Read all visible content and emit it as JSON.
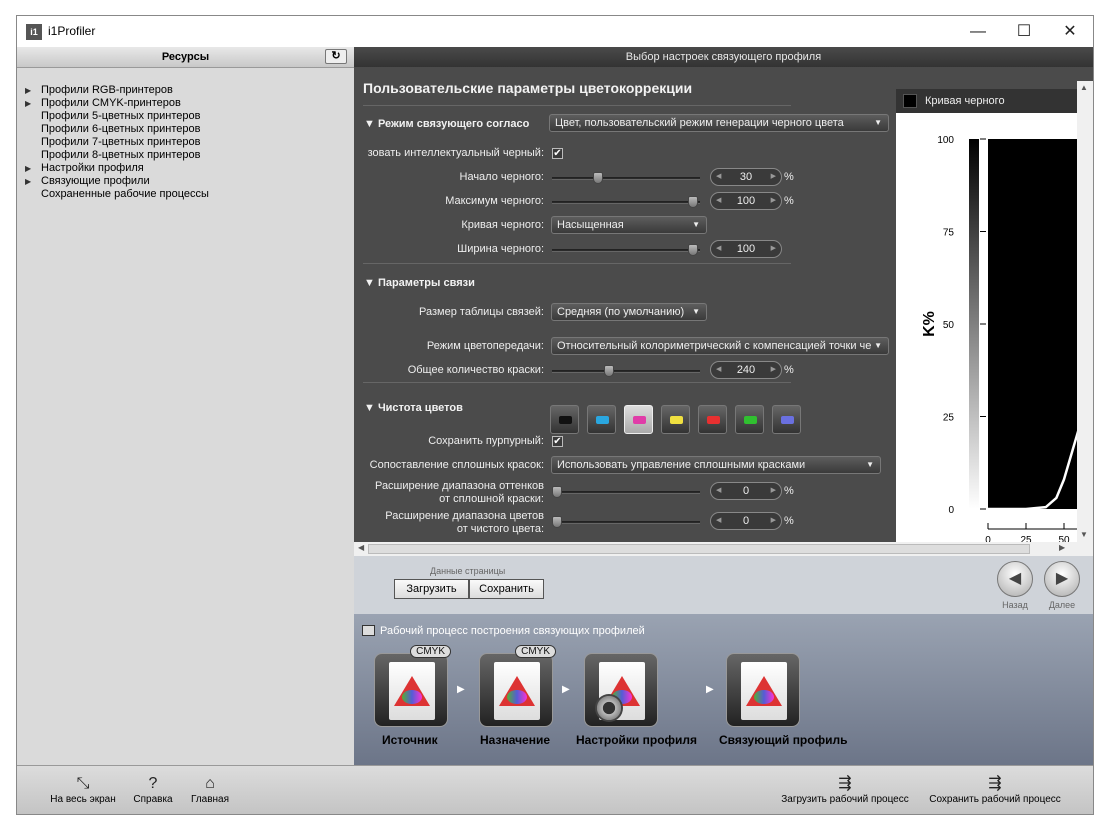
{
  "window": {
    "title": "i1Profiler",
    "minimize": "—",
    "maximize": "☐",
    "close": "✕"
  },
  "left": {
    "header": "Ресурсы",
    "refresh": "↻",
    "tree": [
      {
        "label": "Профили RGB-принтеров",
        "arrow": "▶"
      },
      {
        "label": "Профили CMYK-принтеров",
        "arrow": "▶"
      },
      {
        "label": "Профили 5-цветных принтеров",
        "arrow": ""
      },
      {
        "label": "Профили 6-цветных принтеров",
        "arrow": ""
      },
      {
        "label": "Профили 7-цветных принтеров",
        "arrow": ""
      },
      {
        "label": "Профили 8-цветных принтеров",
        "arrow": ""
      },
      {
        "label": "Настройки профиля",
        "arrow": "▶"
      },
      {
        "label": "Связующие профили",
        "arrow": "▶"
      },
      {
        "label": "Сохраненные рабочие процессы",
        "arrow": ""
      }
    ]
  },
  "panel": {
    "header": "Выбор настроек связующего профиля",
    "title": "Пользовательские параметры цветокоррекции",
    "sec1": "▼ Режим связующего согласо",
    "sec1_value": "Цвет, пользовательский режим генерации черного цвета",
    "intel_black": "зовать интеллектуальный черный:",
    "check": "✔",
    "black_start": {
      "label": "Начало черного:",
      "value": "30",
      "unit": "%",
      "level": 0.3
    },
    "black_max": {
      "label": "Максимум черного:",
      "value": "100",
      "unit": "%",
      "level": 1.0
    },
    "black_curve": {
      "label": "Кривая черного:",
      "value": "Насыщенная"
    },
    "black_width": {
      "label": "Ширина черного:",
      "value": "100",
      "level": 1.0
    },
    "sec2": "▼ Параметры связи",
    "table_size": {
      "label": "Размер таблицы связей:",
      "value": "Средняя (по умолчанию)"
    },
    "render_mode": {
      "label": "Режим цветопередачи:",
      "value": "Относительный колориметрический с компенсацией точки че"
    },
    "total_ink": {
      "label": "Общее количество краски:",
      "value": "240",
      "unit": "%",
      "level": 0.38
    },
    "sec3": "▼ Чистота цветов",
    "keep_magenta": "Сохранить пурпурный:",
    "spot_map": {
      "label": "Сопоставление сплошных красок:",
      "value": "Использовать управление сплошными красками"
    },
    "ext1": {
      "label1": "Расширение диапазона оттенков",
      "label2": "от сплошной краски:",
      "value": "0",
      "unit": "%",
      "level": 0
    },
    "ext2": {
      "label1": "Расширение диапазона цветов",
      "label2": "от чистого цвета:",
      "value": "0",
      "unit": "%",
      "level": 0
    },
    "swatches": [
      "#111111",
      "#2aa7e0",
      "#e03ca8",
      "#f0e040",
      "#e83030",
      "#30c030",
      "#6a70e0"
    ]
  },
  "chart_data": {
    "type": "line",
    "title": "Кривая черного",
    "ylabel": "K%",
    "yticks": [
      "100",
      "75",
      "50",
      "25",
      "0"
    ],
    "xticks": [
      "0",
      "25",
      "50"
    ],
    "ylim": [
      0,
      100
    ],
    "series": [
      {
        "x": [
          0,
          25,
          38,
          45,
          50,
          55,
          60,
          62
        ],
        "y": [
          0,
          0,
          0.5,
          3,
          8,
          15,
          22,
          25
        ]
      }
    ]
  },
  "controls": {
    "page_data": "Данные страницы",
    "load": "Загрузить",
    "save": "Сохранить",
    "back": "Назад",
    "next": "Далее",
    "back_icon": "◀",
    "next_icon": "▶"
  },
  "workflow": {
    "title": "Рабочий процесс построения связующих профилей",
    "steps": [
      {
        "label": "Источник",
        "badge": "CMYK"
      },
      {
        "label": "Назначение",
        "badge": "CMYK"
      },
      {
        "label": "Настройки профиля",
        "badge": ""
      },
      {
        "label": "Связующий профиль",
        "badge": ""
      }
    ],
    "arrow": "▶"
  },
  "footer": {
    "fullscreen": "На весь экран",
    "help": "Справка",
    "home": "Главная",
    "load_wf": "Загрузить рабочий процесс",
    "save_wf": "Сохранить рабочий процесс",
    "fullscreen_icon": "⤡",
    "help_icon": "?",
    "home_icon": "⌂",
    "load_icon": "⇶",
    "save_icon": "⇶"
  }
}
